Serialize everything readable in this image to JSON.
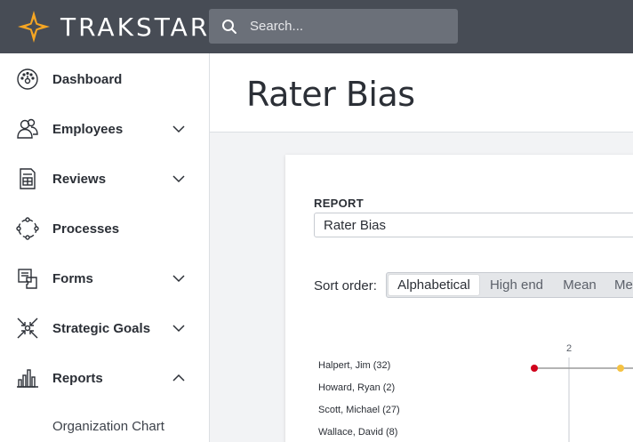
{
  "app": {
    "brand": "TRAKSTAR",
    "accent_color": "#f6a623",
    "search": {
      "placeholder": "Search..."
    }
  },
  "sidebar": {
    "items": [
      {
        "label": "Dashboard",
        "icon": "dashboard-gauge-icon",
        "chevron": "none"
      },
      {
        "label": "Employees",
        "icon": "people-icon",
        "chevron": "chevron-down-icon"
      },
      {
        "label": "Reviews",
        "icon": "review-document-icon",
        "chevron": "chevron-down-icon"
      },
      {
        "label": "Processes",
        "icon": "process-cycle-icon",
        "chevron": "none"
      },
      {
        "label": "Forms",
        "icon": "forms-puzzle-icon",
        "chevron": "none"
      },
      {
        "label": "Strategic Goals",
        "icon": "goals-arrows-icon",
        "chevron": "chevron-down-icon"
      },
      {
        "label": "Reports",
        "icon": "bar-chart-icon",
        "chevron": "chevron-up-icon"
      }
    ],
    "sub_items": [
      {
        "label": "Organization Chart"
      }
    ]
  },
  "page": {
    "title": "Rater Bias"
  },
  "report": {
    "label": "REPORT",
    "selected": "Rater Bias",
    "sort": {
      "label": "Sort order:",
      "options": [
        "Alphabetical",
        "High end",
        "Mean",
        "Me"
      ],
      "active": "Alphabetical"
    }
  },
  "chart_data": {
    "type": "scatter",
    "x_tick_labels": [
      "2"
    ],
    "raters": [
      {
        "name": "Halpert, Jim (32)"
      },
      {
        "name": "Howard, Ryan (2)"
      },
      {
        "name": "Scott, Michael (27)"
      },
      {
        "name": "Wallace, David (8)"
      }
    ],
    "colors": {
      "low": "#d0021b",
      "mid": "#f5c242",
      "line": "#9b9b9b",
      "grid": "#c7cbd1"
    }
  }
}
